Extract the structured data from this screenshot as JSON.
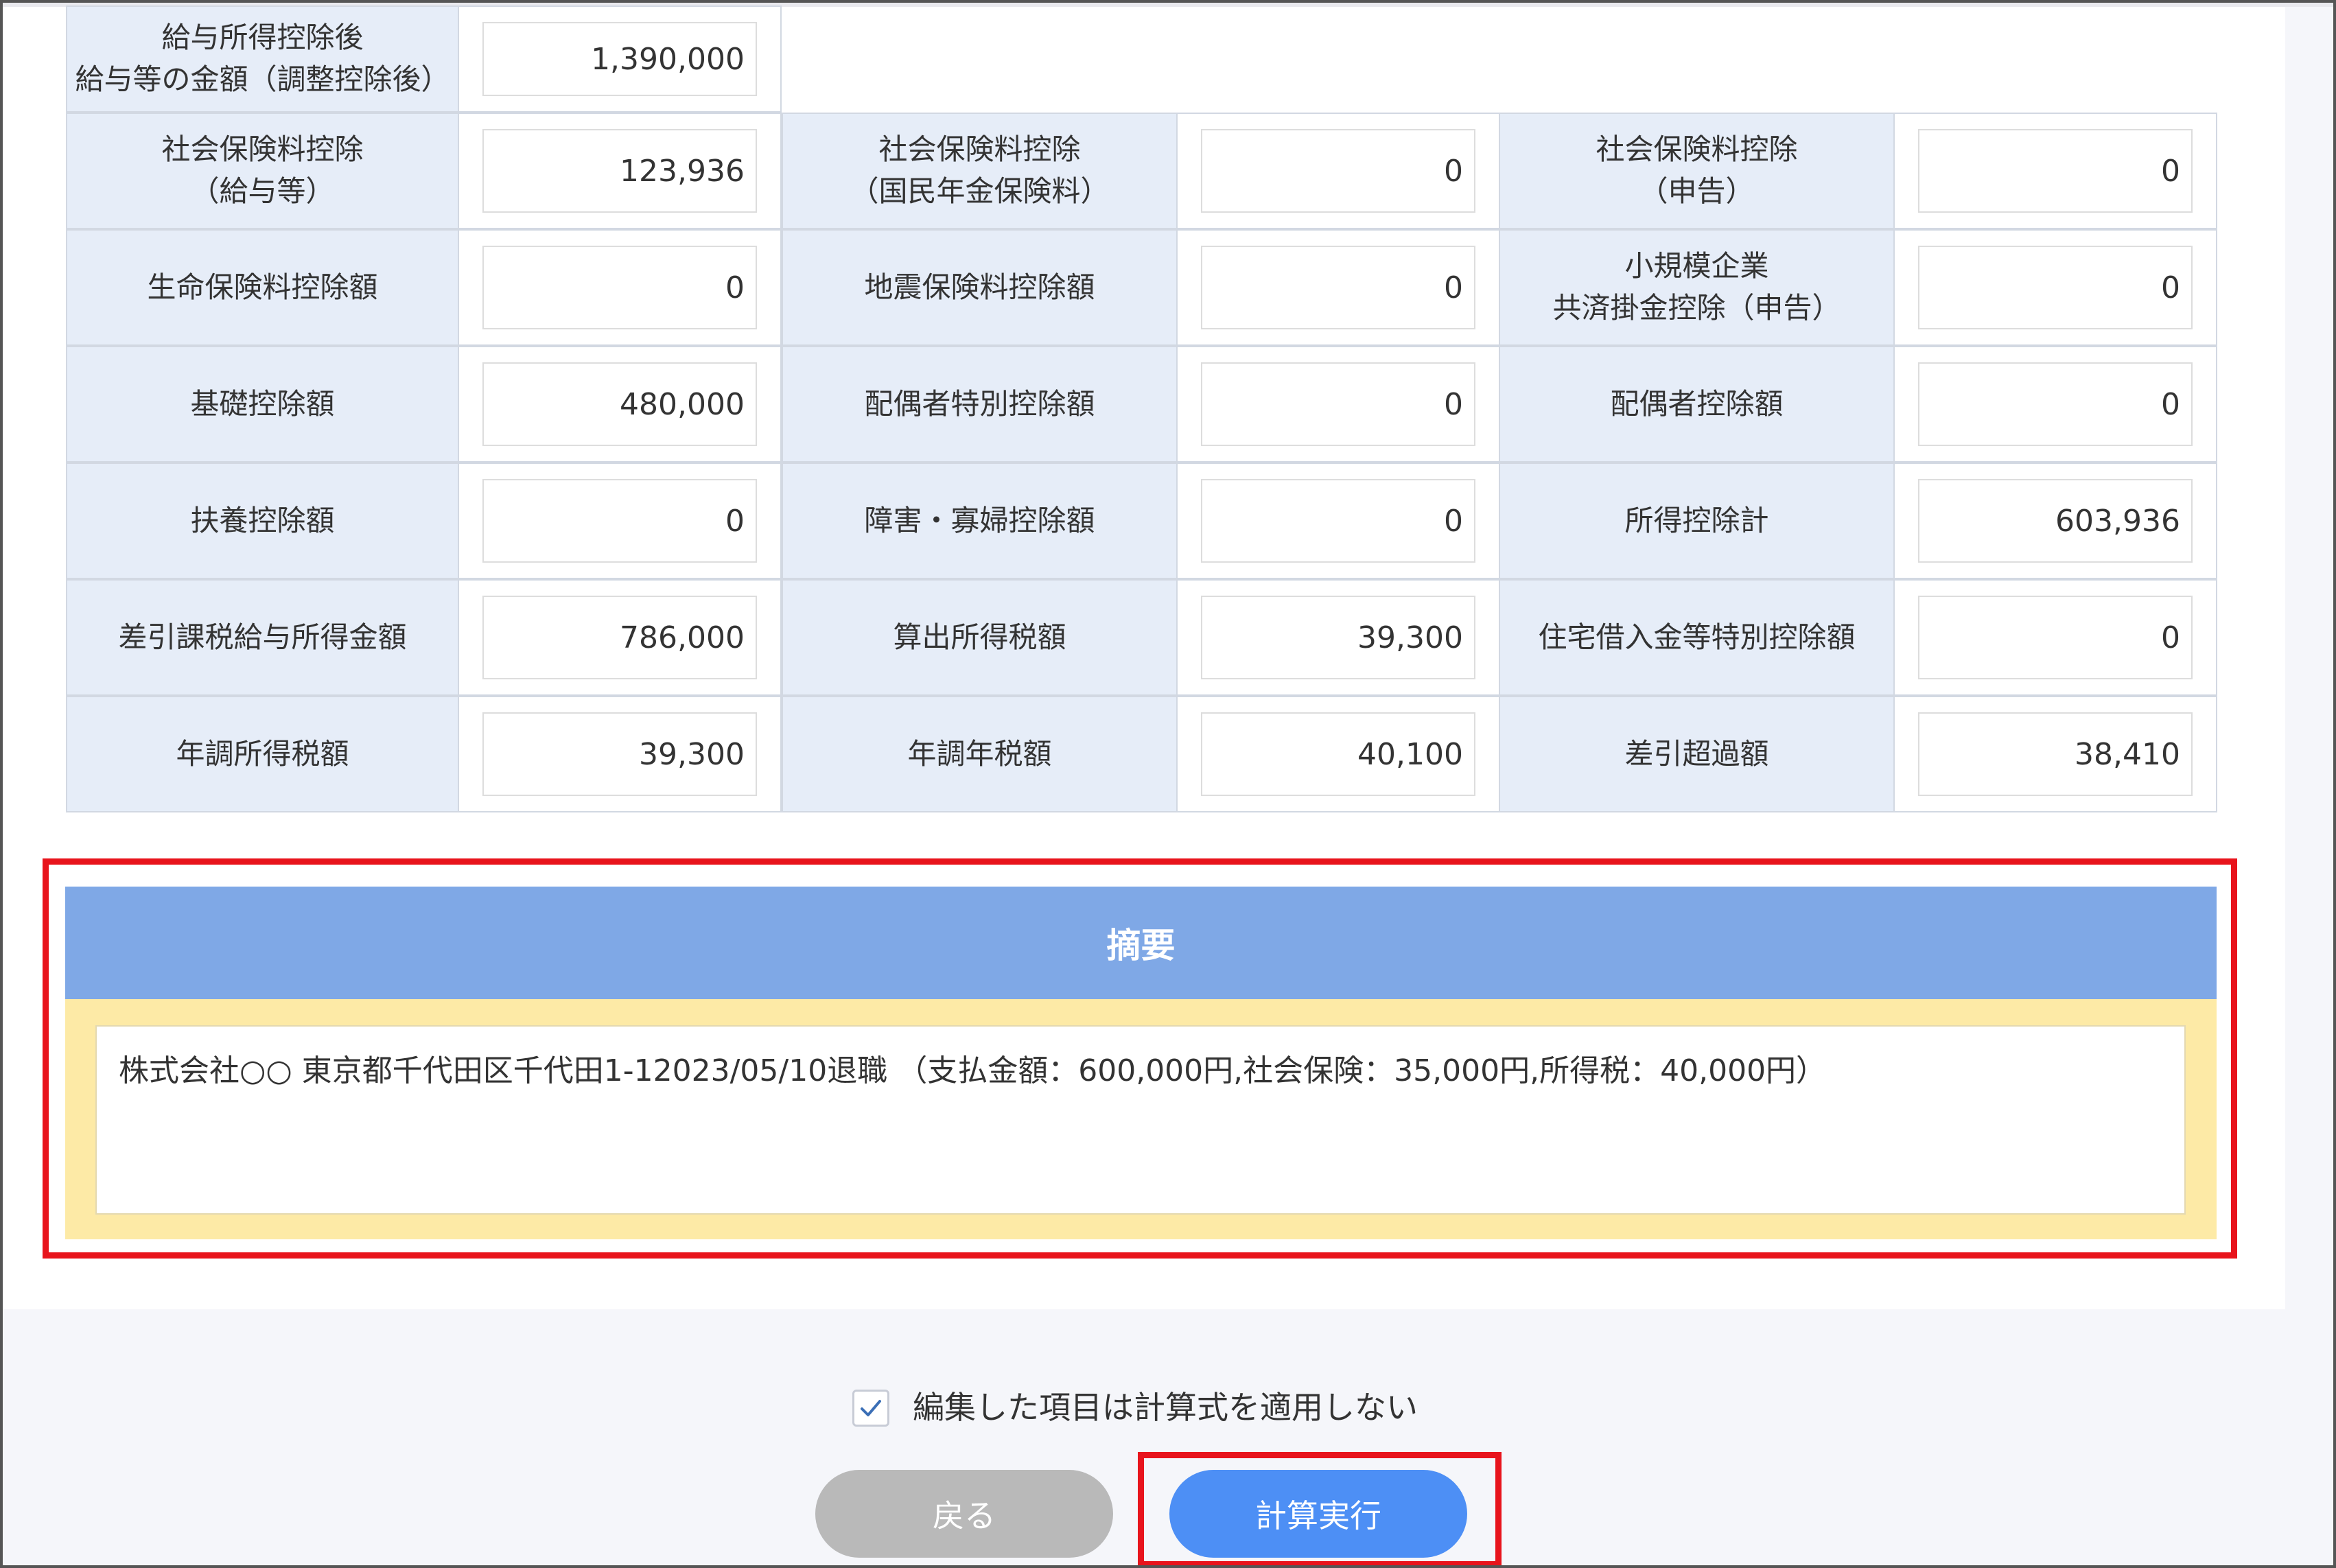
{
  "table": {
    "top_row": {
      "label": "給与所得控除後\n給与等の金額（調整控除後）",
      "value": "1,390,000"
    },
    "rows": [
      [
        {
          "label": "社会保険料控除\n（給与等）",
          "value": "123,936"
        },
        {
          "label": "社会保険料控除\n（国民年金保険料）",
          "value": "0"
        },
        {
          "label": "社会保険料控除\n（申告）",
          "value": "0"
        }
      ],
      [
        {
          "label": "生命保険料控除額",
          "value": "0"
        },
        {
          "label": "地震保険料控除額",
          "value": "0"
        },
        {
          "label": "小規模企業\n共済掛金控除（申告）",
          "value": "0"
        }
      ],
      [
        {
          "label": "基礎控除額",
          "value": "480,000"
        },
        {
          "label": "配偶者特別控除額",
          "value": "0"
        },
        {
          "label": "配偶者控除額",
          "value": "0"
        }
      ],
      [
        {
          "label": "扶養控除額",
          "value": "0"
        },
        {
          "label": "障害・寡婦控除額",
          "value": "0"
        },
        {
          "label": "所得控除計",
          "value": "603,936"
        }
      ],
      [
        {
          "label": "差引課税給与所得金額",
          "value": "786,000"
        },
        {
          "label": "算出所得税額",
          "value": "39,300"
        },
        {
          "label": "住宅借入金等特別控除額",
          "value": "0"
        }
      ],
      [
        {
          "label": "年調所得税額",
          "value": "39,300"
        },
        {
          "label": "年調年税額",
          "value": "40,100"
        },
        {
          "label": "差引超過額",
          "value": "38,410"
        }
      ]
    ]
  },
  "summary": {
    "title": "摘要",
    "text": "株式会社○○ 東京都千代田区千代田1-12023/05/10退職 （支払金額：600,000円,社会保険：35,000円,所得税：40,000円）"
  },
  "options": {
    "checkbox_label": "編集した項目は計算式を適用しない",
    "checked": true
  },
  "buttons": {
    "back": "戻る",
    "calculate": "計算実行"
  },
  "colors": {
    "label_bg": "#e6edf8",
    "summary_header": "#7fa8e6",
    "summary_bg": "#fdeaa6",
    "primary_button": "#4d8ff5",
    "disabled_button": "#b9b9b9",
    "highlight": "#e8141c"
  },
  "icons": {
    "checkbox": "check-icon"
  }
}
